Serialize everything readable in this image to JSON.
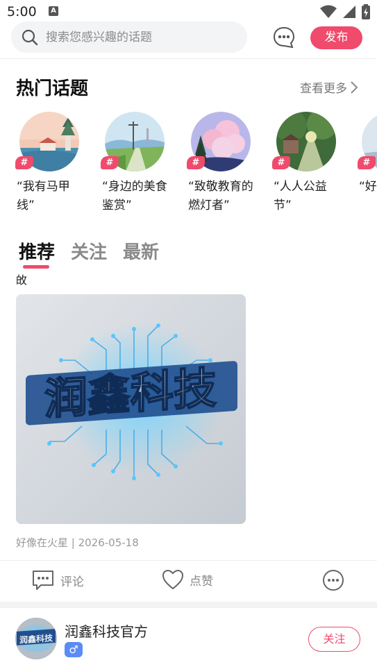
{
  "status": {
    "time": "5:00",
    "notification_letter": "A"
  },
  "search": {
    "placeholder": "搜索您感兴趣的话题"
  },
  "header": {
    "publish_label": "发布"
  },
  "hot_topics": {
    "title": "热门话题",
    "see_more": "查看更多",
    "tag_symbol": "#",
    "items": [
      {
        "label": "“我有马甲线”"
      },
      {
        "label": "“身边的美食鉴赏”"
      },
      {
        "label": "“致敬教育的燃灯者”"
      },
      {
        "label": "“人人公益节”"
      },
      {
        "label": "“好图鉴"
      }
    ]
  },
  "tabs": [
    {
      "label": "推荐"
    },
    {
      "label": "关注"
    },
    {
      "label": "最新"
    }
  ],
  "post": {
    "snippet": "敀",
    "image_text": "润鑫科技",
    "meta": "好像在火星 | 2026-05-18",
    "comment_label": "评论",
    "like_label": "点赞"
  },
  "author": {
    "name": "润鑫科技官方",
    "gender_symbol": "♂",
    "follow_label": "关注",
    "avatar_text": "润鑫科技"
  },
  "colors": {
    "accent": "#f04a6c",
    "male_badge": "#5b8cf5"
  }
}
